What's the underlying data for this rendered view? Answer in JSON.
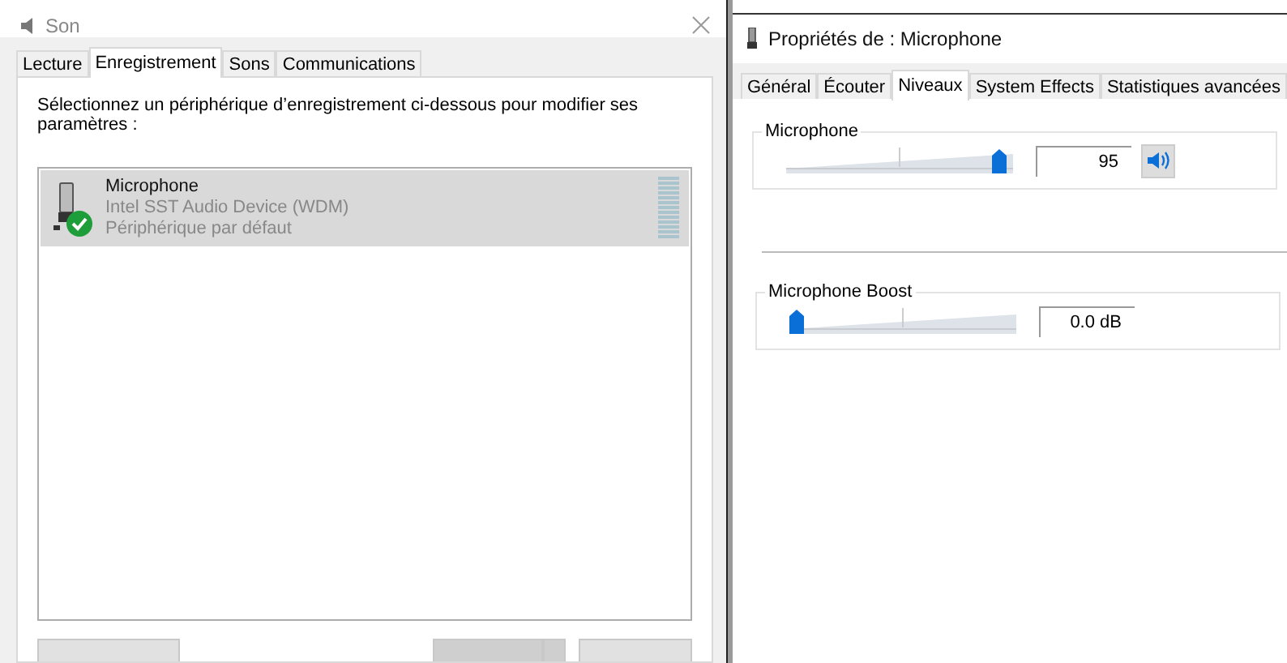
{
  "sound_window": {
    "title": "Son",
    "tabs": [
      {
        "label": "Lecture",
        "selected": false
      },
      {
        "label": "Enregistrement",
        "selected": true
      },
      {
        "label": "Sons",
        "selected": false
      },
      {
        "label": "Communications",
        "selected": false
      }
    ],
    "instruction": "Sélectionnez un périphérique d’enregistrement ci-dessous pour modifier ses paramètres :",
    "devices": [
      {
        "name": "Microphone",
        "driver": "Intel SST Audio Device (WDM)",
        "status": "Périphérique par défaut",
        "selected": true,
        "default": true
      }
    ]
  },
  "properties_window": {
    "title": "Propriétés de : Microphone",
    "tabs": [
      {
        "label": "Général",
        "selected": false
      },
      {
        "label": "Écouter",
        "selected": false
      },
      {
        "label": "Niveaux",
        "selected": true
      },
      {
        "label": "System Effects",
        "selected": false
      },
      {
        "label": "Statistiques avancées",
        "selected": false
      }
    ],
    "levels": [
      {
        "name": "Microphone",
        "level": 0.95,
        "reading": "95",
        "muted": false
      },
      {
        "name": "Microphone Boost",
        "level": 0.0,
        "reading": "0.0 dB"
      }
    ]
  }
}
